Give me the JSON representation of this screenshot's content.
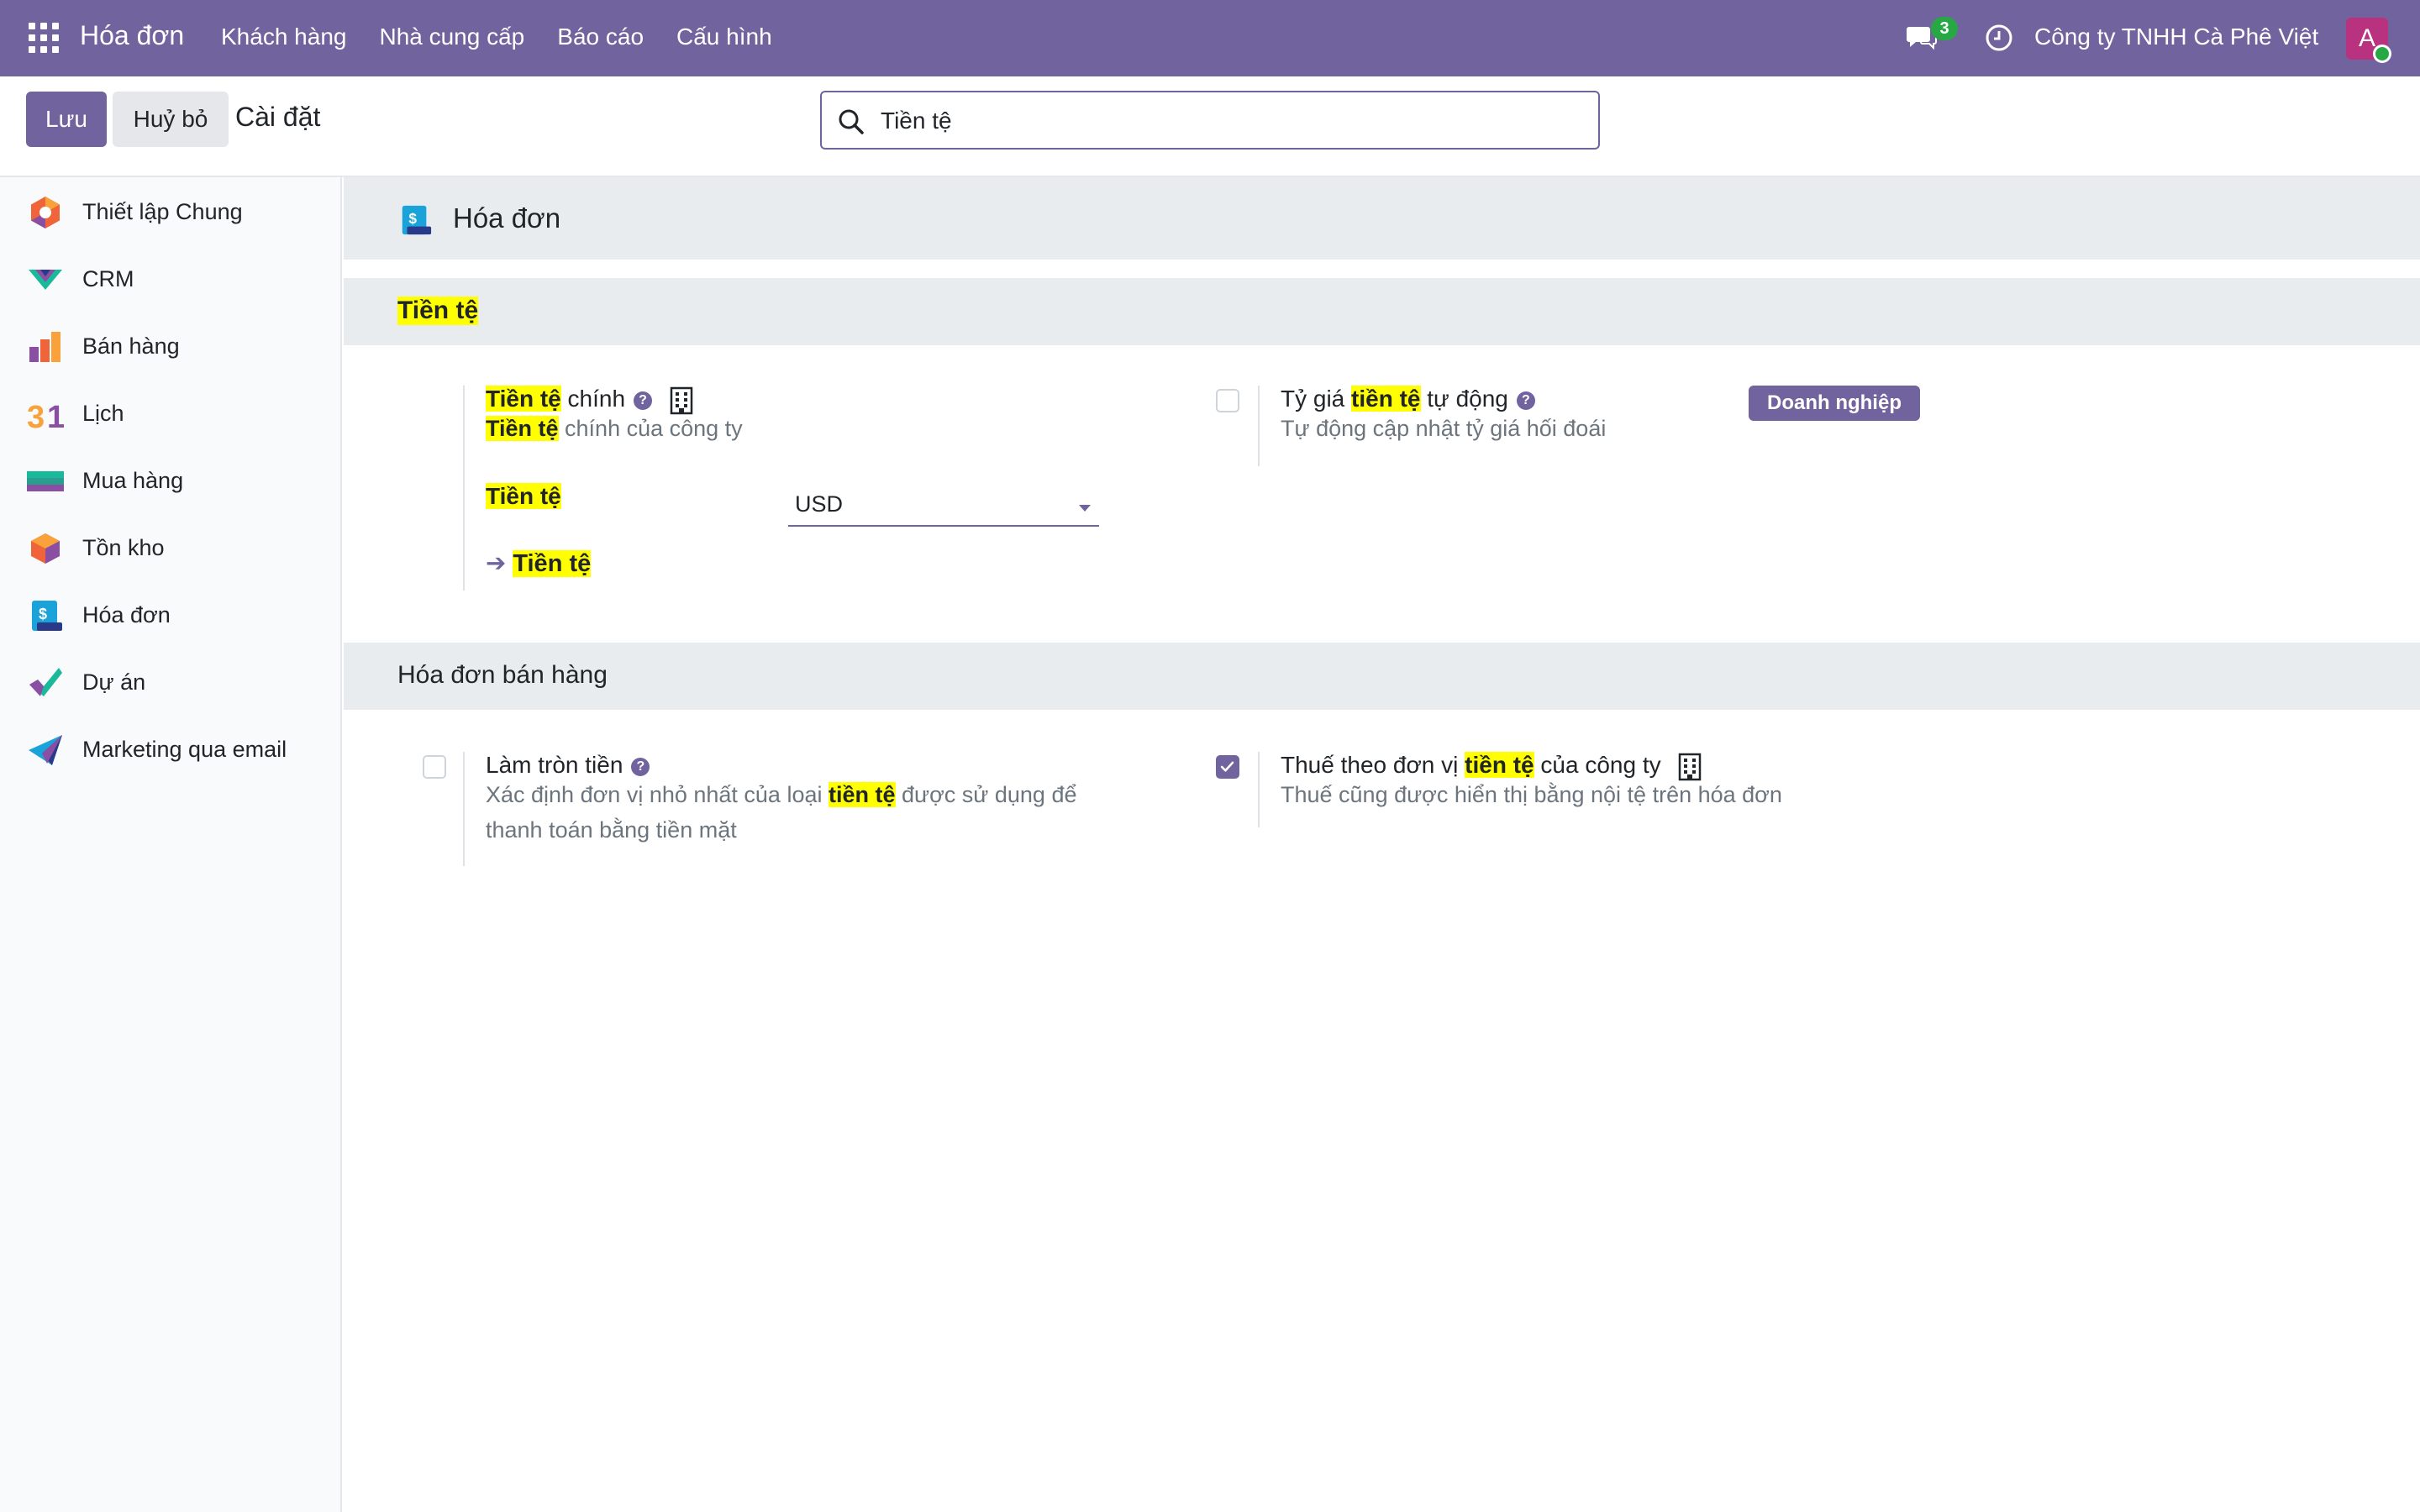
{
  "navbar": {
    "brand": "Hóa đơn",
    "menu": [
      "Khách hàng",
      "Nhà cung cấp",
      "Báo cáo",
      "Cấu hình"
    ],
    "chat_count": "3",
    "company": "Công ty TNHH Cà Phê Việt",
    "avatar_letter": "A",
    "accent_color": "#71639e"
  },
  "control_panel": {
    "save_label": "Lưu",
    "cancel_label": "Huỷ bỏ",
    "title": "Cài đặt",
    "search_value": "Tiền tệ"
  },
  "sidebar": {
    "items": [
      {
        "label": "Thiết lập Chung",
        "icon": "settings-general-icon"
      },
      {
        "label": "CRM",
        "icon": "crm-icon"
      },
      {
        "label": "Bán hàng",
        "icon": "sales-icon"
      },
      {
        "label": "Lịch",
        "icon": "calendar-icon"
      },
      {
        "label": "Mua hàng",
        "icon": "purchase-icon"
      },
      {
        "label": "Tồn kho",
        "icon": "inventory-icon"
      },
      {
        "label": "Hóa đơn",
        "icon": "invoicing-icon"
      },
      {
        "label": "Dự án",
        "icon": "project-icon"
      },
      {
        "label": "Marketing qua email",
        "icon": "email-marketing-icon"
      }
    ]
  },
  "main": {
    "app_title": "Hóa đơn",
    "sections": [
      {
        "title": "Tiền tệ",
        "settings": {
          "main_currency": {
            "title_hl": "Tiền tệ",
            "title_rest": " chính",
            "desc_hl": "Tiền tệ",
            "desc_rest": " chính của công ty",
            "field_label": "Tiền tệ",
            "field_value": "USD",
            "link_label": "Tiền tệ"
          },
          "auto_rate": {
            "title_pre": "Tỷ giá ",
            "title_hl": "tiền tệ",
            "title_post": " tự động",
            "desc": "Tự động cập nhật tỷ giá hối đoái",
            "badge": "Doanh nghiệp",
            "checked": false
          }
        }
      },
      {
        "title": "Hóa đơn bán hàng",
        "settings": {
          "rounding": {
            "title": "Làm tròn tiền",
            "desc_pre": "Xác định đơn vị nhỏ nhất của loại ",
            "desc_hl": "tiền tệ",
            "desc_post": " được sử dụng để",
            "desc_line2": "thanh toán bằng tiền mặt",
            "checked": false
          },
          "tax_currency": {
            "title_pre": "Thuế theo đơn vị ",
            "title_hl": "tiền tệ",
            "title_post": " của công ty",
            "desc": "Thuế cũng được hiển thị bằng nội tệ trên hóa đơn",
            "checked": true
          }
        }
      }
    ]
  }
}
